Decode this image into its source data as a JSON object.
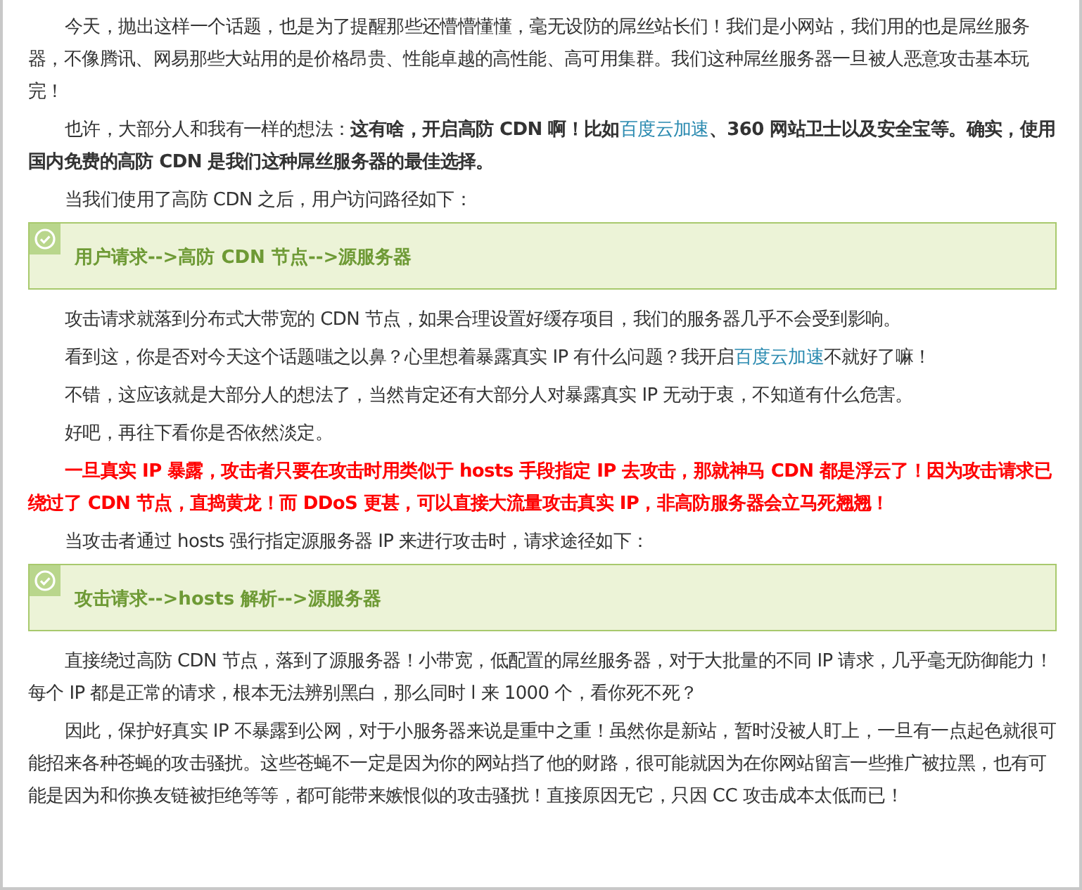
{
  "article": [
    {
      "kind": "text",
      "parts": [
        {
          "text": "今天，抛出这样一个话题，也是为了提醒那些还懵懵懂懂，毫无设防的屌丝站长们！我们是小网站，我们用的也是屌丝服务器，不像腾讯、网易那些大站用的是价格昂贵、性能卓越的高性能、高可用集群。我们这种屌丝服务器一旦被人恶意攻击基本玩完！"
        }
      ]
    },
    {
      "kind": "text",
      "parts": [
        {
          "text": "也许，大部分人和我有一样的想法：**这有啥，开启高防 CDN 啊！比如**"
        },
        {
          "link": "百度云加速"
        },
        {
          "text": "**、360 网站卫士以及安全宝等。确实，使用国内免费的高防 CDN 是我们这种屌丝服务器的最佳选择。**"
        }
      ]
    },
    {
      "kind": "text",
      "parts": [
        {
          "text": "当我们使用了高防 CDN 之后，用户访问路径如下："
        }
      ]
    },
    {
      "kind": "note",
      "parts": [
        {
          "text": "用户请求-->高防 CDN 节点-->源服务器"
        }
      ]
    },
    {
      "kind": "text",
      "parts": [
        {
          "text": "攻击请求就落到分布式大带宽的 CDN 节点，如果合理设置好缓存项目，我们的服务器几乎不会受到影响。"
        }
      ]
    },
    {
      "kind": "text",
      "parts": [
        {
          "text": "看到这，你是否对今天这个话题嗤之以鼻？心里想着暴露真实 IP 有什么问题？我开启"
        },
        {
          "link": "百度云加速"
        },
        {
          "text": "不就好了嘛！"
        }
      ]
    },
    {
      "kind": "text",
      "parts": [
        {
          "text": "不错，这应该就是大部分人的想法了，当然肯定还有大部分人对暴露真实 IP 无动于衷，不知道有什么危害。"
        }
      ]
    },
    {
      "kind": "text",
      "parts": [
        {
          "text": "好吧，再往下看你是否依然淡定。"
        }
      ]
    },
    {
      "kind": "warning",
      "parts": [
        {
          "text": "一旦真实 IP 暴露，攻击者只要在攻击时用类似于 hosts 手段指定 IP 去攻击，那就神马 CDN 都是浮云了！因为攻击请求已绕过了 CDN 节点，直捣黄龙！而 DDoS 更甚，可以直接大流量攻击真实 IP，非高防服务器会立马死翘翘！"
        }
      ]
    },
    {
      "kind": "text",
      "parts": [
        {
          "text": "当攻击者通过 hosts 强行指定源服务器 IP 来进行攻击时，请求途径如下："
        }
      ]
    },
    {
      "kind": "note",
      "parts": [
        {
          "text": "攻击请求-->hosts 解析-->源服务器"
        }
      ]
    },
    {
      "kind": "text",
      "parts": [
        {
          "text": "直接绕过高防 CDN 节点，落到了源服务器！小带宽，低配置的屌丝服务器，对于大批量的不同 IP 请求，几乎毫无防御能力！每个 IP 都是正常的请求，根本无法辨别黑白，那么同时 l 来 1000 个，看你死不死？"
        }
      ]
    },
    {
      "kind": "text",
      "parts": [
        {
          "text": "因此，保护好真实 IP 不暴露到公网，对于小服务器来说是重中之重！虽然你是新站，暂时没被人盯上，一旦有一点起色就很可能招来各种苍蝇的攻击骚扰。这些苍蝇不一定是因为你的网站挡了他的财路，很可能就因为在你网站留言一些推广被拉黑，也有可能是因为和你换友链被拒绝等等，都可能带来嫉恨似的攻击骚扰！直接原因无它，只因 CC 攻击成本太低而已！"
        }
      ]
    }
  ]
}
